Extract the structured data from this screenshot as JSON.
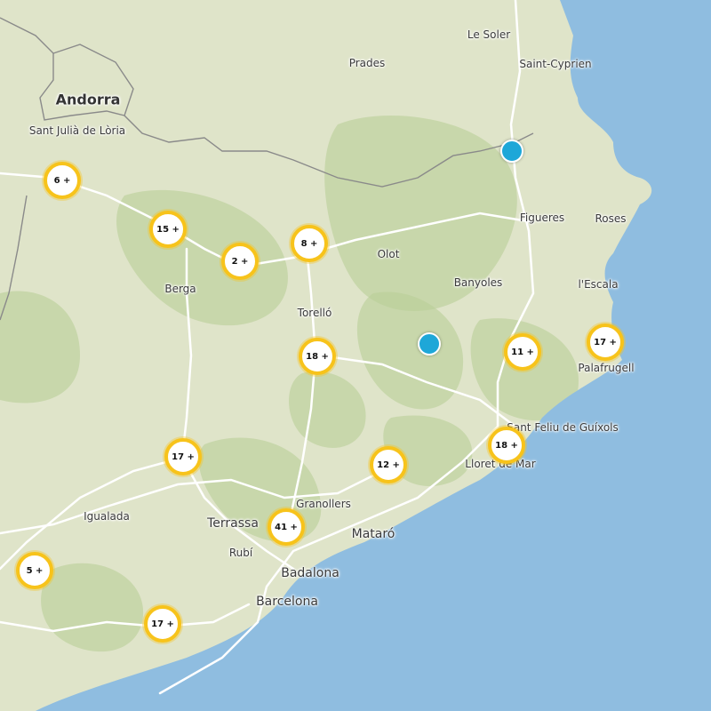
{
  "colors": {
    "land": "#dfe4c9",
    "forest": "#b9cf98",
    "sea": "#8fbde0",
    "road": "#ffffff",
    "border": "#8a8a8a",
    "cluster_ring": "#f7c31b",
    "marker": "#1ea7d8"
  },
  "places": [
    {
      "label": "Le Soler",
      "type": "town"
    },
    {
      "label": "Prades",
      "type": "town"
    },
    {
      "label": "Saint-Cyprien",
      "type": "town"
    },
    {
      "label": "Andorra",
      "type": "country"
    },
    {
      "label": "Sant Julià de Lòria",
      "type": "town"
    },
    {
      "label": "Figueres",
      "type": "town"
    },
    {
      "label": "Roses",
      "type": "town"
    },
    {
      "label": "Olot",
      "type": "town"
    },
    {
      "label": "Berga",
      "type": "town"
    },
    {
      "label": "Banyoles",
      "type": "town"
    },
    {
      "label": "l'Escala",
      "type": "town"
    },
    {
      "label": "Torelló",
      "type": "town"
    },
    {
      "label": "Palafrugell",
      "type": "town"
    },
    {
      "label": "Sant Feliu de Guíxols",
      "type": "town"
    },
    {
      "label": "Lloret de Mar",
      "type": "town"
    },
    {
      "label": "Igualada",
      "type": "town"
    },
    {
      "label": "Granollers",
      "type": "town"
    },
    {
      "label": "Terrassa",
      "type": "city"
    },
    {
      "label": "Mataró",
      "type": "city"
    },
    {
      "label": "Rubí",
      "type": "town"
    },
    {
      "label": "Badalona",
      "type": "city"
    },
    {
      "label": "Barcelona",
      "type": "city"
    }
  ],
  "clusters": [
    {
      "label": "6 +"
    },
    {
      "label": "15 +"
    },
    {
      "label": "2 +"
    },
    {
      "label": "8 +"
    },
    {
      "label": "18 +"
    },
    {
      "label": "11 +"
    },
    {
      "label": "17 +"
    },
    {
      "label": "17 +"
    },
    {
      "label": "18 +"
    },
    {
      "label": "12 +"
    },
    {
      "label": "41 +"
    },
    {
      "label": "5 +"
    },
    {
      "label": "17 +"
    }
  ],
  "markers": [
    {
      "icon": "location-marker-icon"
    },
    {
      "icon": "location-marker-icon"
    }
  ]
}
